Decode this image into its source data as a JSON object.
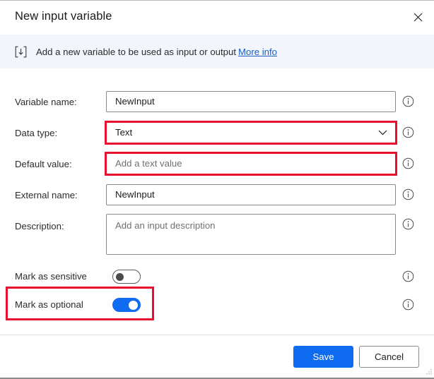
{
  "dialog": {
    "title": "New input variable",
    "close_label": "Close",
    "close_icon": "close-icon"
  },
  "banner": {
    "icon": "input-variable-icon",
    "text": "Add a new variable to be used as input or output",
    "link_label": "More info",
    "background": "#f2f5fb",
    "link_color": "#1b5fc1"
  },
  "form": {
    "fields": [
      {
        "label": "Variable name:",
        "type": "text",
        "value": "NewInput",
        "placeholder": "",
        "highlighted": false,
        "info_icon": "info-circle-icon"
      },
      {
        "label": "Data type:",
        "type": "combobox",
        "value": "Text",
        "placeholder": "",
        "highlighted": true,
        "chevron_icon": "chevron-down-icon",
        "info_icon": "info-circle-icon"
      },
      {
        "label": "Default value:",
        "type": "text",
        "value": "",
        "placeholder": "Add a text value",
        "highlighted": true,
        "info_icon": "info-circle-icon"
      },
      {
        "label": "External name:",
        "type": "text",
        "value": "NewInput",
        "placeholder": "",
        "highlighted": false,
        "info_icon": "info-circle-icon"
      },
      {
        "label": "Description:",
        "type": "textarea",
        "value": "",
        "placeholder": "Add an input description",
        "highlighted": false,
        "info_icon": "info-circle-icon"
      }
    ],
    "toggles": [
      {
        "label": "Mark as sensitive",
        "state": "off",
        "highlighted": false,
        "info_icon": "info-circle-icon"
      },
      {
        "label": "Mark as optional",
        "state": "on",
        "highlighted": true,
        "info_icon": "info-circle-icon"
      }
    ]
  },
  "footer": {
    "save_label": "Save",
    "cancel_label": "Cancel",
    "primary_color": "#0f6cf0"
  },
  "annotation": {
    "color": "#e8112d"
  }
}
